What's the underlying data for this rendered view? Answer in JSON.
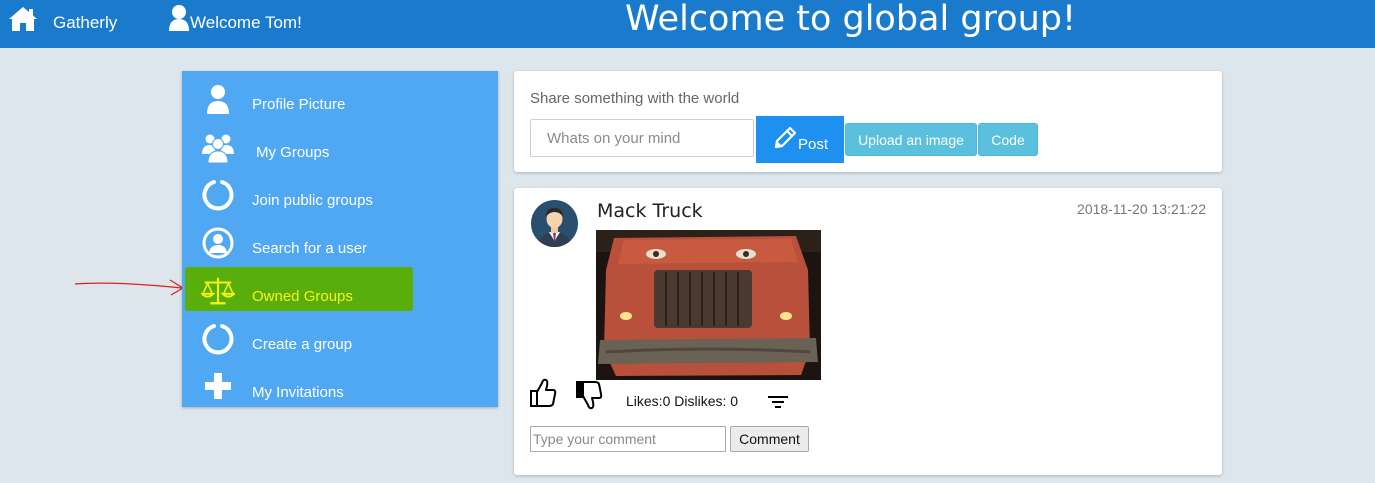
{
  "navbar": {
    "brand": "Gatherly",
    "welcome": "Welcome Tom!",
    "page_title": "Welcome to global group!"
  },
  "sidebar": {
    "items": [
      {
        "label": "Profile Picture",
        "icon": "user-icon"
      },
      {
        "label": "My Groups",
        "icon": "users-icon"
      },
      {
        "label": "Join public groups",
        "icon": "circle-notch-icon"
      },
      {
        "label": "Search for a user",
        "icon": "user-circle-icon"
      },
      {
        "label": "Owned Groups",
        "icon": "balance-scale-icon",
        "highlighted": true
      },
      {
        "label": "Create a group",
        "icon": "circle-notch-icon"
      },
      {
        "label": "My Invitations",
        "icon": "plus-icon"
      }
    ]
  },
  "colors": {
    "navbar": "#1a7acc",
    "sidebar": "#4fa8f1",
    "highlight": "#5aae0c",
    "highlight_text": "#f4f414",
    "primary_button": "#1e90f0",
    "info_button": "#5bc0de",
    "annotation_arrow": "#e02020"
  },
  "share": {
    "label": "Share something with the world",
    "placeholder": "Whats on your mind",
    "post_label": "Post",
    "upload_label": "Upload an image",
    "code_label": "Code"
  },
  "post": {
    "author": "Mack Truck",
    "timestamp": "2018-11-20 13:21:22",
    "likes_text": "Likes:0 Dislikes: 0",
    "comment_placeholder": "Type your comment",
    "comment_button": "Comment"
  }
}
